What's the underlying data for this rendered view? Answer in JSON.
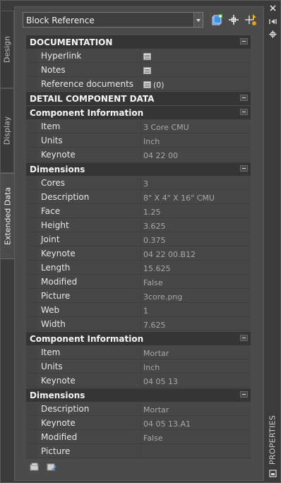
{
  "side_tabs": [
    {
      "label": "Design"
    },
    {
      "label": "Display"
    },
    {
      "label": "Extended Data"
    }
  ],
  "selector": {
    "value": "Block Reference"
  },
  "toolbar": {
    "icons": [
      "add-property-set-icon",
      "pick-point-icon",
      "quick-select-icon"
    ]
  },
  "palette_title": "PROPERTIES",
  "sections": {
    "documentation": {
      "title": "DOCUMENTATION",
      "rows": [
        {
          "key": "Hyperlink",
          "value": ""
        },
        {
          "key": "Notes",
          "value": ""
        },
        {
          "key": "Reference documents",
          "value": "(0)"
        }
      ]
    },
    "detail": {
      "title": "DETAIL COMPONENT DATA"
    },
    "comp1": {
      "title": "Component Information",
      "rows": [
        {
          "key": "Item",
          "value": "3 Core CMU"
        },
        {
          "key": "Units",
          "value": "Inch"
        },
        {
          "key": "Keynote",
          "value": "04 22 00"
        }
      ]
    },
    "dim1": {
      "title": "Dimensions",
      "rows": [
        {
          "key": "Cores",
          "value": "3"
        },
        {
          "key": "Description",
          "value": "8\" X 4\" X 16\" CMU"
        },
        {
          "key": "Face",
          "value": "1.25"
        },
        {
          "key": "Height",
          "value": "3.625"
        },
        {
          "key": "Joint",
          "value": "0.375"
        },
        {
          "key": "Keynote",
          "value": "04 22 00.B12"
        },
        {
          "key": "Length",
          "value": "15.625"
        },
        {
          "key": "Modified",
          "value": "False"
        },
        {
          "key": "Picture",
          "value": "3core.png"
        },
        {
          "key": "Web",
          "value": "1"
        },
        {
          "key": "Width",
          "value": "7.625"
        }
      ]
    },
    "comp2": {
      "title": "Component Information",
      "rows": [
        {
          "key": "Item",
          "value": "Mortar"
        },
        {
          "key": "Units",
          "value": "Inch"
        },
        {
          "key": "Keynote",
          "value": "04 05 13"
        }
      ]
    },
    "dim2": {
      "title": "Dimensions",
      "rows": [
        {
          "key": "Description",
          "value": "Mortar"
        },
        {
          "key": "Keynote",
          "value": "04 05 13.A1"
        },
        {
          "key": "Modified",
          "value": "False"
        },
        {
          "key": "Picture",
          "value": ""
        }
      ]
    }
  }
}
